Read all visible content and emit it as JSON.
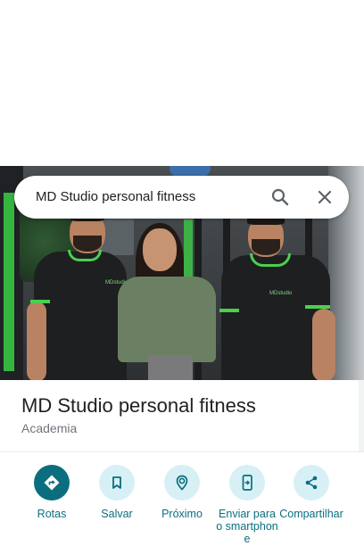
{
  "search": {
    "query": "MD Studio personal fitness"
  },
  "place": {
    "title": "MD Studio personal fitness",
    "category": "Academia",
    "shirt_logo": "MDstudio"
  },
  "actions": [
    {
      "label": "Rotas",
      "icon": "directions-icon"
    },
    {
      "label": "Salvar",
      "icon": "bookmark-icon"
    },
    {
      "label": "Próximo",
      "icon": "nearby-icon"
    },
    {
      "label": "Enviar para o smartphone",
      "icon": "send-to-phone-icon"
    },
    {
      "label": "Compartilhar",
      "icon": "share-icon"
    }
  ],
  "colors": {
    "accent": "#0b6e7f",
    "action_bg": "#d7f0f6",
    "shirt_trim": "#4ad04f"
  }
}
